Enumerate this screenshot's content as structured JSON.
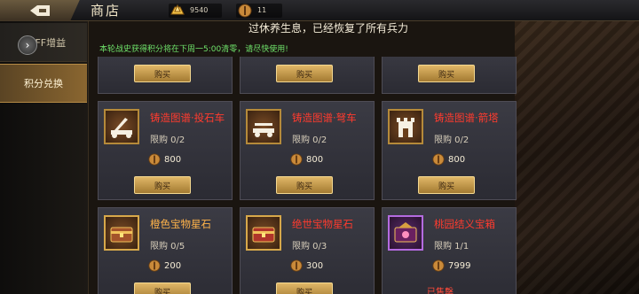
{
  "header": {
    "title": "商店",
    "resources": [
      {
        "icon": "gold-ingot-icon",
        "value": "9540"
      },
      {
        "icon": "points-coin-icon",
        "value": "11"
      }
    ]
  },
  "notice": {
    "top": "过休养生息，已经恢复了所有兵力",
    "line": "本轮战史获得积分将在下周一5:00清零，请尽快使用!"
  },
  "sidebar": {
    "tabs": [
      {
        "label": "BUFF增益",
        "active": false
      },
      {
        "label": "积分兑换",
        "active": true
      }
    ]
  },
  "buy_label": "购买",
  "items": [
    {
      "name": "铸造图谱·投石车",
      "limit": "限购 0/2",
      "price": "800",
      "action": "购买",
      "name_color": "#ff3b2e"
    },
    {
      "name": "铸造图谱·弩车",
      "limit": "限购 0/2",
      "price": "800",
      "action": "购买",
      "name_color": "#ff3b2e"
    },
    {
      "name": "铸造图谱·箭塔",
      "limit": "限购 0/2",
      "price": "800",
      "action": "购买",
      "name_color": "#ff3b2e"
    },
    {
      "name": "橙色宝物星石",
      "limit": "限购 0/5",
      "price": "200",
      "action": "购买",
      "name_color": "#ffb34a"
    },
    {
      "name": "绝世宝物星石",
      "limit": "限购 0/3",
      "price": "300",
      "action": "购买",
      "name_color": "#ff3b2e"
    },
    {
      "name": "桃园结义宝箱",
      "limit": "限购 1/1",
      "price": "7999",
      "action": "已售罄",
      "name_color": "#ff3b2e"
    }
  ]
}
